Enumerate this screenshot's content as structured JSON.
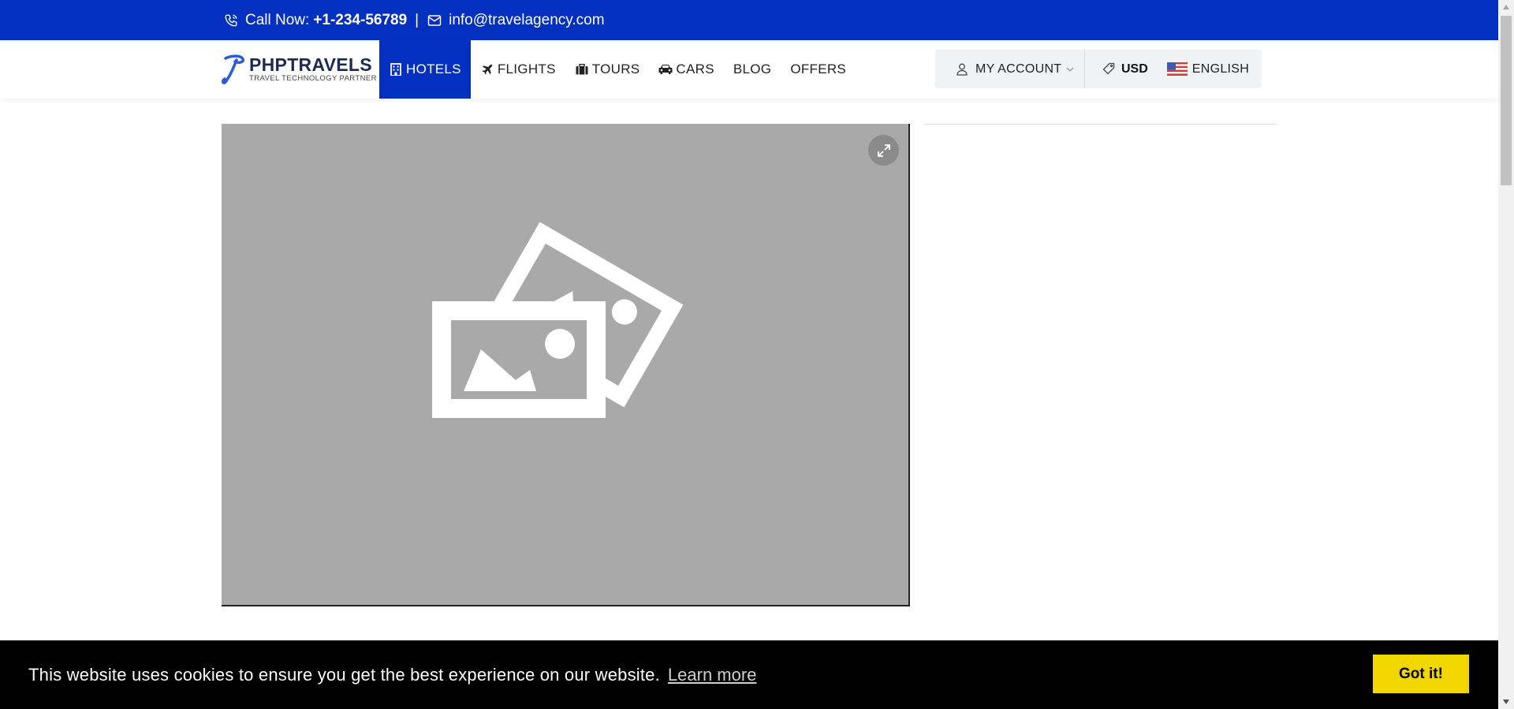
{
  "topbar": {
    "call_label": "Call Now:",
    "phone": "+1-234-56789",
    "separator": "|",
    "email": "info@travelagency.com",
    "bg_color": "#0330bf"
  },
  "logo": {
    "title": "PHPTRAVELS",
    "subtitle": "TRAVEL TECHNOLOGY PARTNER"
  },
  "nav": {
    "items": [
      {
        "label": "HOTELS",
        "icon": "building-icon"
      },
      {
        "label": "FLIGHTS",
        "icon": "plane-icon"
      },
      {
        "label": "TOURS",
        "icon": "suitcase-icon"
      },
      {
        "label": "CARS",
        "icon": "car-icon"
      },
      {
        "label": "BLOG",
        "icon": ""
      },
      {
        "label": "OFFERS",
        "icon": ""
      }
    ],
    "active": "HOTELS"
  },
  "account": {
    "my_account": "MY ACCOUNT",
    "currency": "USD",
    "language": "ENGLISH"
  },
  "cookie": {
    "message": "This website uses cookies to ensure you get the best experience on our website.",
    "learn_more": "Learn more",
    "accept": "Got it!"
  },
  "colors": {
    "primary": "#0330bf",
    "gallery_bg": "#a9a9a9",
    "cookie_button": "#f1d600"
  }
}
